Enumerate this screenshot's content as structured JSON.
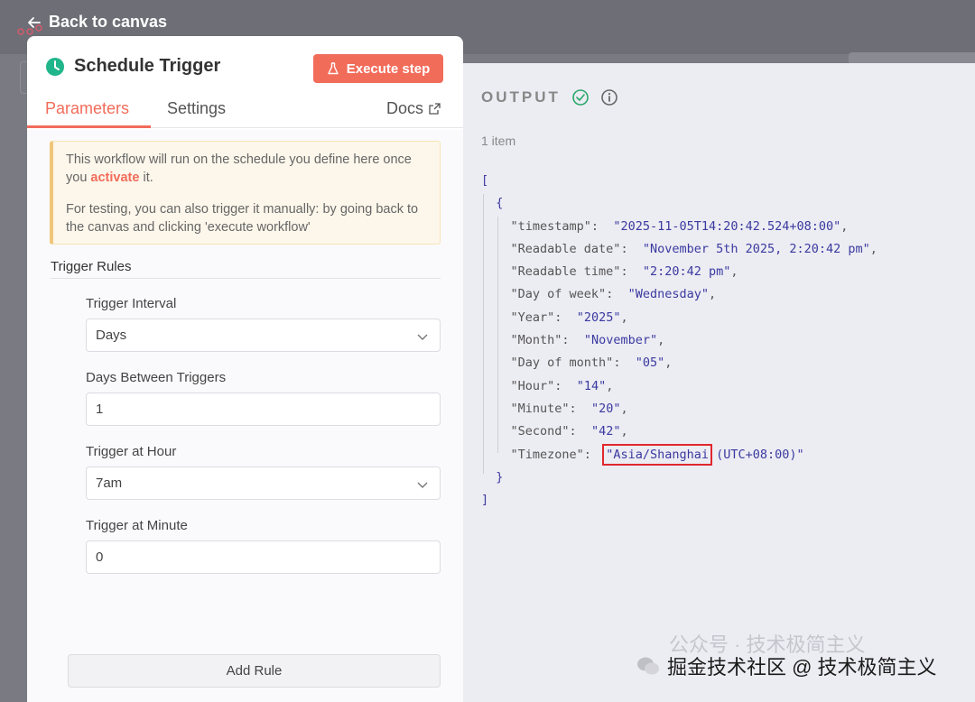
{
  "nav": {
    "back_label": "Back to canvas"
  },
  "node": {
    "title": "Schedule Trigger",
    "execute_label": "Execute step",
    "accent": "#f26c5a",
    "clock_color": "#20b58a"
  },
  "tabs": [
    {
      "label": "Parameters",
      "active": true
    },
    {
      "label": "Settings",
      "active": false
    }
  ],
  "docs_label": "Docs",
  "notice": {
    "line1_before": "This workflow will run on the schedule you define here once you ",
    "activate_link": "activate",
    "line1_after": " it.",
    "line2": "For testing, you can also trigger it manually: by going back to the canvas and clicking 'execute workflow'"
  },
  "rules": {
    "section_title": "Trigger Rules",
    "fields": [
      {
        "label": "Trigger Interval",
        "value": "Days",
        "type": "select"
      },
      {
        "label": "Days Between Triggers",
        "value": "1",
        "type": "input"
      },
      {
        "label": "Trigger at Hour",
        "value": "7am",
        "type": "select"
      },
      {
        "label": "Trigger at Minute",
        "value": "0",
        "type": "input"
      }
    ],
    "add_rule_label": "Add Rule"
  },
  "output": {
    "title": "OUTPUT",
    "item_count": "1 item",
    "open_bracket": "[",
    "open_brace": "{",
    "close_brace": "}",
    "close_bracket": "]",
    "entries": [
      {
        "key": "\"timestamp\"",
        "value": "\"2025-11-05T14:20:42.524+08:00\""
      },
      {
        "key": "\"Readable date\"",
        "value": "\"November 5th 2025, 2:20:42 pm\""
      },
      {
        "key": "\"Readable time\"",
        "value": "\"2:20:42 pm\""
      },
      {
        "key": "\"Day of week\"",
        "value": "\"Wednesday\""
      },
      {
        "key": "\"Year\"",
        "value": "\"2025\""
      },
      {
        "key": "\"Month\"",
        "value": "\"November\""
      },
      {
        "key": "\"Day of month\"",
        "value": "\"05\""
      },
      {
        "key": "\"Hour\"",
        "value": "\"14\""
      },
      {
        "key": "\"Minute\"",
        "value": "\"20\""
      },
      {
        "key": "\"Second\"",
        "value": "\"42\""
      }
    ],
    "timezone": {
      "key": "\"Timezone\"",
      "highlighted": "\"Asia/Shanghai",
      "rest": " (UTC+08:00)\""
    }
  },
  "watermark": {
    "faint": "公众号 · 技术极简主义",
    "strong": "掘金技术社区 @ 技术极简主义"
  }
}
